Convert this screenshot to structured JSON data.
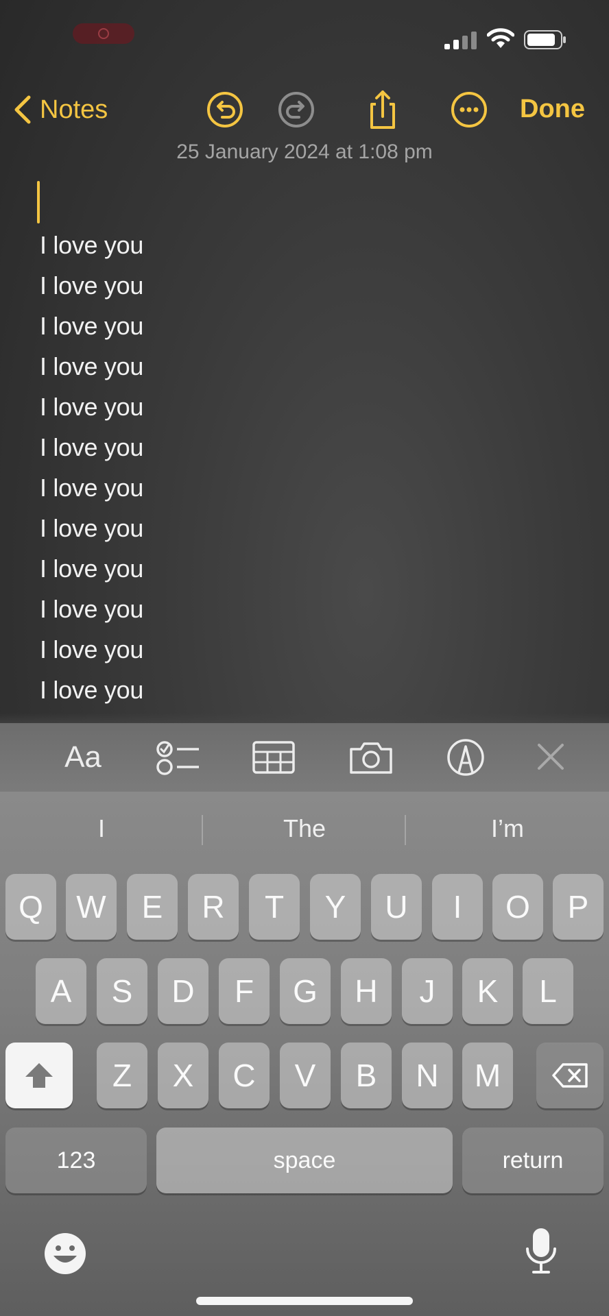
{
  "status_bar": {
    "icons": [
      "recording-indicator-icon",
      "cellular-signal-icon",
      "wifi-icon",
      "battery-icon"
    ]
  },
  "toolbar": {
    "back_label": "Notes",
    "done_label": "Done",
    "icons": [
      "undo-icon",
      "redo-icon",
      "share-icon",
      "more-icon"
    ],
    "accent_color": "#f4c542"
  },
  "note": {
    "date": "25 January 2024 at 1:08 pm",
    "lines": [
      "I love you",
      "I love you",
      "I love you",
      "I love you",
      "I love you",
      "I love you",
      "I love you",
      "I love you",
      "I love you",
      "I love you",
      "I love you",
      "I love you"
    ]
  },
  "format_bar": {
    "text_style_label": "Aa",
    "icons": [
      "checklist-icon",
      "table-icon",
      "camera-icon",
      "markup-icon",
      "close-icon"
    ]
  },
  "keyboard": {
    "suggestions": [
      "I",
      "The",
      "I’m"
    ],
    "row1": [
      "Q",
      "W",
      "E",
      "R",
      "T",
      "Y",
      "U",
      "I",
      "O",
      "P"
    ],
    "row2": [
      "A",
      "S",
      "D",
      "F",
      "G",
      "H",
      "J",
      "K",
      "L"
    ],
    "row3": [
      "Z",
      "X",
      "C",
      "V",
      "B",
      "N",
      "M"
    ],
    "numbers_label": "123",
    "space_label": "space",
    "return_label": "return",
    "icons": [
      "shift-icon",
      "delete-icon",
      "emoji-icon",
      "microphone-icon"
    ]
  }
}
